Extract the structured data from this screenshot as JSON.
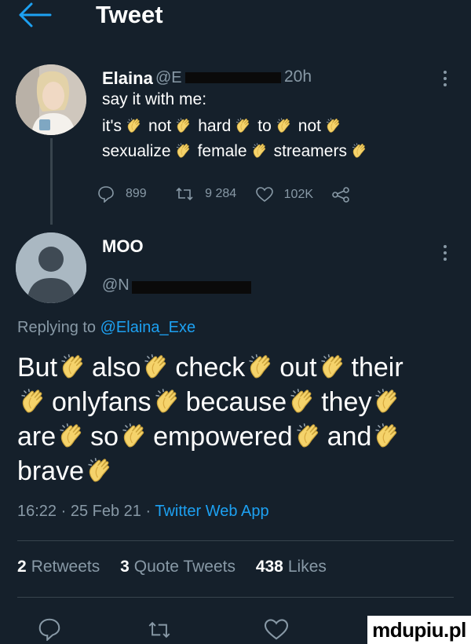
{
  "header": {
    "title": "Tweet"
  },
  "original_tweet": {
    "display_name": "Elaina",
    "handle_prefix": "@E",
    "timestamp": "20h",
    "line1": "say it with me:",
    "line2_words": [
      "it's",
      "not",
      "hard",
      "to",
      "not"
    ],
    "line3_words": [
      "sexualize",
      "female",
      "streamers"
    ],
    "stats": {
      "replies": "899",
      "retweets": "9 284",
      "likes": "102K"
    }
  },
  "reply": {
    "display_name": "MOO",
    "handle_prefix": "@N",
    "replying_label": "Replying to",
    "replying_handle": "@Elaina_Exe",
    "line1": [
      "But",
      "also",
      "check",
      "out",
      "their"
    ],
    "line2": [
      "onlyfans",
      "because",
      "they"
    ],
    "line3": [
      "are",
      "so",
      "empowered",
      "and"
    ],
    "line4": [
      "brave"
    ],
    "meta_time": "16:22 · 25 Feb 21 ·",
    "meta_source": "Twitter Web App"
  },
  "counts": {
    "retweets_num": "2",
    "retweets_label": "Retweets",
    "quotes_num": "3",
    "quotes_label": "Quote Tweets",
    "likes_num": "438",
    "likes_label": "Likes"
  },
  "watermark": "mdupiu.pl",
  "colors": {
    "background": "#15202b",
    "accent": "#1da1f2",
    "muted": "#8899a6",
    "divider": "#38444d"
  },
  "icons": [
    "back-arrow-icon",
    "reply-icon",
    "retweet-icon",
    "like-icon",
    "share-icon",
    "more-icon",
    "clap-emoji"
  ]
}
